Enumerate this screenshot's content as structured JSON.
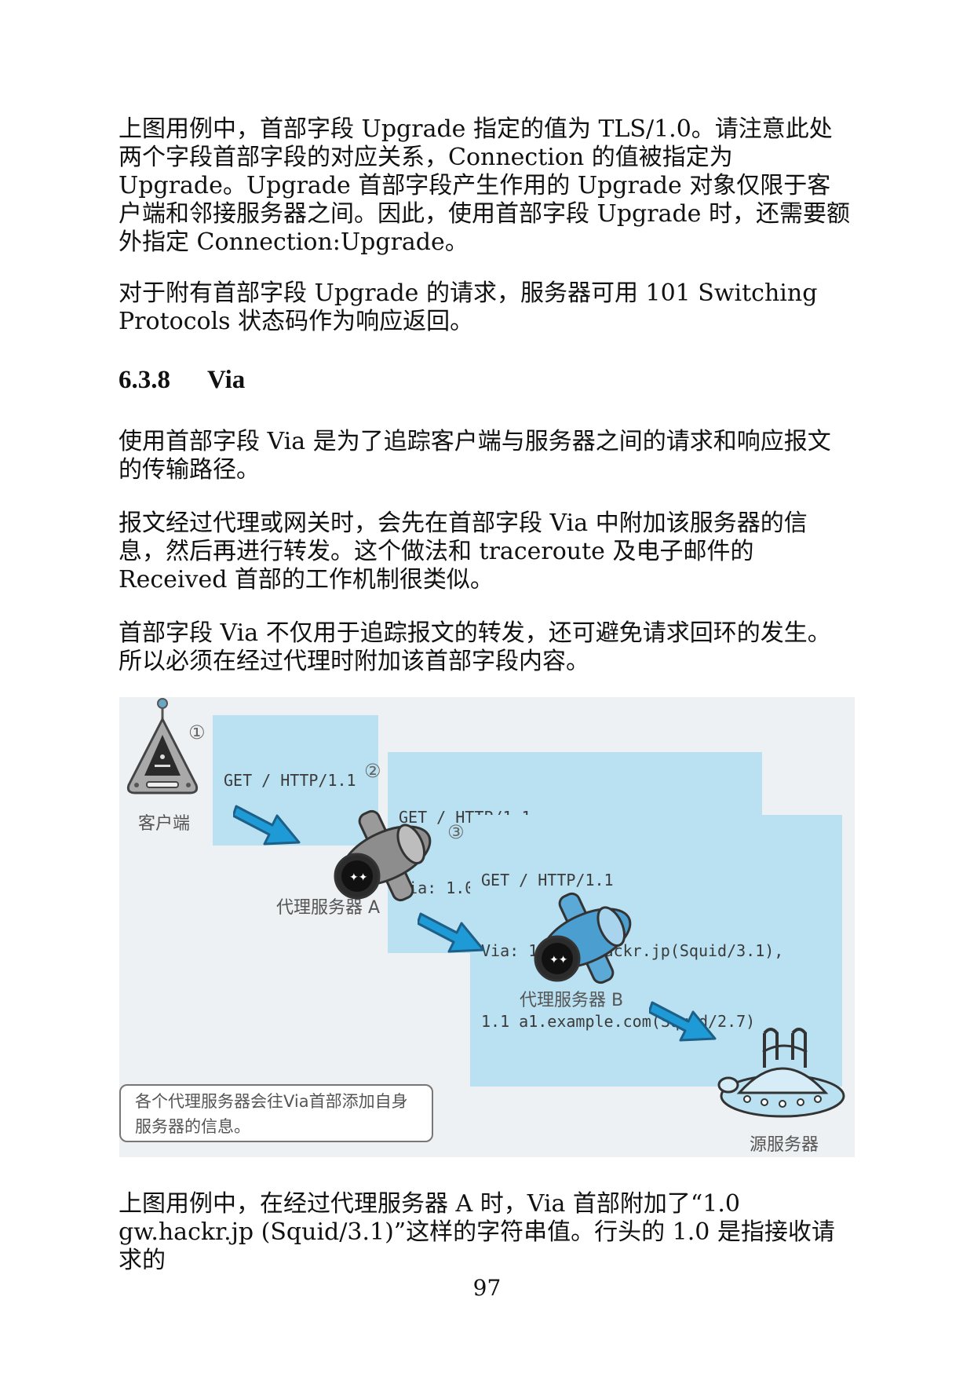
{
  "paragraphs": {
    "p1": "上图用例中，首部字段 Upgrade 指定的值为 TLS/1.0。请注意此处两个字段首部字段的对应关系，Connection 的值被指定为 Upgrade。Upgrade 首部字段产生作用的 Upgrade 对象仅限于客户端和邻接服务器之间。因此，使用首部字段 Upgrade 时，还需要额外指定 Connection:Upgrade。",
    "p2": "对于附有首部字段 Upgrade 的请求，服务器可用 101 Switching Protocols 状态码作为响应返回。",
    "p3": "使用首部字段 Via 是为了追踪客户端与服务器之间的请求和响应报文的传输路径。",
    "p4": "报文经过代理或网关时，会先在首部字段 Via 中附加该服务器的信息，然后再进行转发。这个做法和 traceroute 及电子邮件的 Received 首部的工作机制很类似。",
    "p5": "首部字段 Via 不仅用于追踪报文的转发，还可避免请求回环的发生。所以必须在经过代理时附加该首部字段内容。",
    "p6": "上图用例中，在经过代理服务器 A 时，Via 首部附加了“1.0 gw.hackr.jp (Squid/3.1)”这样的字符串值。行头的 1.0 是指接收请求的"
  },
  "heading": {
    "number": "6.3.8",
    "title": "Via"
  },
  "figure": {
    "steps": [
      "①",
      "②",
      "③"
    ],
    "requests": [
      [
        "GET / HTTP/1.1"
      ],
      [
        "GET / HTTP/1.1",
        "Via: 1.0 gw.hackr.jp(Squid/3.1)"
      ],
      [
        "GET / HTTP/1.1",
        "Via: 1.0 gw.hackr.jp(Squid/3.1),",
        "1.1 a1.example.com(Squid/2.7)"
      ]
    ],
    "labels": {
      "client": "客户端",
      "proxy_a": "代理服务器 A",
      "proxy_b": "代理服务器 B",
      "origin": "源服务器"
    },
    "note": "各个代理服务器会往Via首部添加自身服务器的信息。",
    "colors": {
      "arrow": "#1e9ad6",
      "bubble": "#b9e1f2"
    }
  },
  "page_number": "97"
}
